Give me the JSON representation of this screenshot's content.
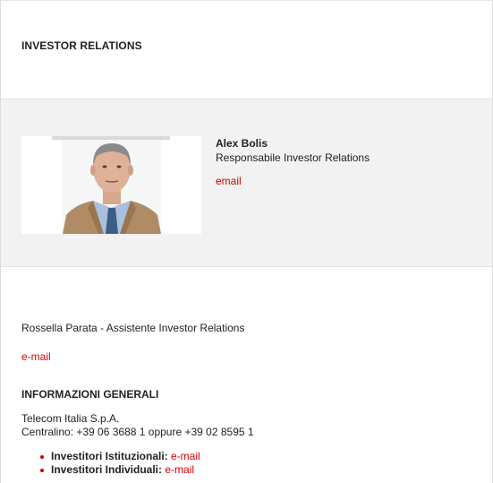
{
  "header": {
    "title": "INVESTOR RELATIONS"
  },
  "contact": {
    "name": "Alex Bolis",
    "role": "Responsabile Investor Relations",
    "email_label": "email"
  },
  "assistant": {
    "text": "Rossella Parata - Assistente Investor Relations",
    "email_label": "e-mail"
  },
  "general": {
    "title": "INFORMAZIONI GENERALI",
    "company": "Telecom Italia S.p.A.",
    "phone": "Centralino: +39 06 3688 1 oppure +39 02 8595 1",
    "items": [
      {
        "label": "Investitori Istituzionali:",
        "link": "e-mail"
      },
      {
        "label": "Investitori Individuali:",
        "link": "e-mail"
      }
    ]
  },
  "colors": {
    "accent": "#d40000",
    "card_background": "#f2f2f2",
    "text": "#222222"
  }
}
